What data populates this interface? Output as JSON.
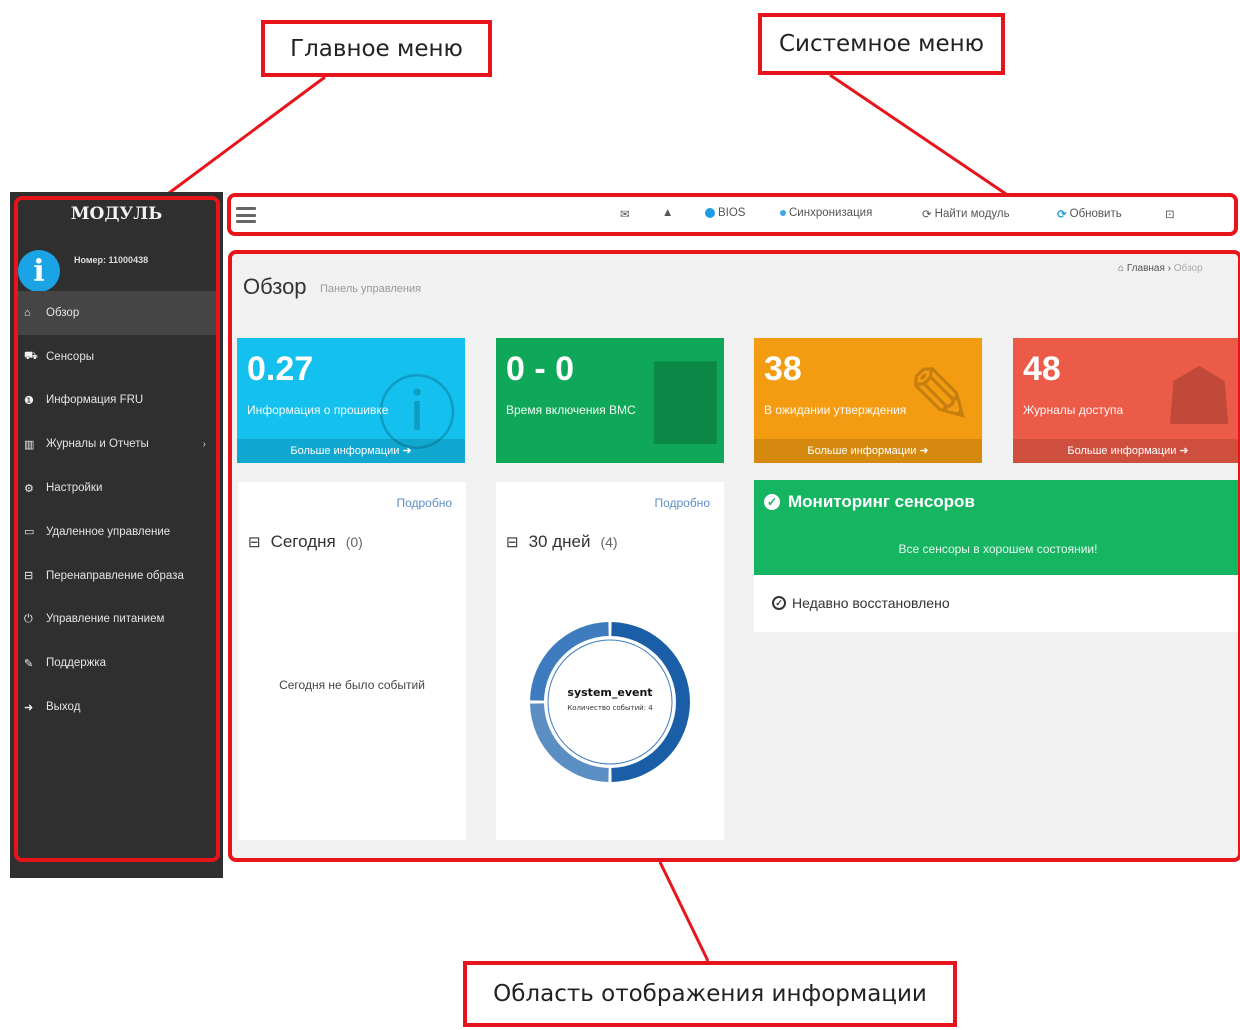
{
  "callouts": {
    "main_menu": "Главное меню",
    "system_menu": "Системное меню",
    "info_area": "Область отображения информации"
  },
  "sidebar": {
    "brand": "МОДУЛЬ",
    "user_number": "Номер: 11000438",
    "items": [
      {
        "label": "Обзор",
        "icon": "home-icon",
        "active": true
      },
      {
        "label": "Сенсоры",
        "icon": "car-icon"
      },
      {
        "label": "Информация FRU",
        "icon": "info-icon"
      },
      {
        "label": "Журналы и Отчеты",
        "icon": "bar-chart-icon",
        "has_submenu": true
      },
      {
        "label": "Настройки",
        "icon": "gear-icon"
      },
      {
        "label": "Удаленное управление",
        "icon": "monitor-icon"
      },
      {
        "label": "Перенаправление образа",
        "icon": "disk-icon"
      },
      {
        "label": "Управление питанием",
        "icon": "power-icon"
      },
      {
        "label": "Поддержка",
        "icon": "wrench-icon"
      },
      {
        "label": "Выход",
        "icon": "sign-out-icon"
      }
    ]
  },
  "topbar": {
    "bios_label": "BIOS",
    "sync_label": "Синхронизация",
    "find_label": "Найти модуль",
    "refresh_label": "Обновить",
    "icons": [
      "menu-icon",
      "envelope-icon",
      "warning-icon",
      "bios-status-icon",
      "sync-icon",
      "find-module-icon",
      "refresh-icon",
      "power-off-icon"
    ],
    "accent_color": "#1e9be6"
  },
  "content": {
    "title": "Обзор",
    "subtitle": "Панель управления",
    "breadcrumb": {
      "home": "Главная",
      "current": "Обзор"
    }
  },
  "stats": [
    {
      "value": "0.27",
      "label": "Информация о прошивке",
      "footer": "Больше информации",
      "color": "#13c0ee",
      "icon": "info-icon"
    },
    {
      "value": "0 - 0",
      "label": "Время включения BMC",
      "footer": "",
      "color": "#0fa858",
      "icon": "bar-chart-icon"
    },
    {
      "value": "38",
      "label": "В ожидании утверждения",
      "footer": "Больше информации",
      "color": "#f39c12",
      "icon": "pushpin-icon"
    },
    {
      "value": "48",
      "label": "Журналы доступа",
      "footer": "Больше информации",
      "color": "#ec5a48",
      "icon": "user-icon"
    }
  ],
  "events": {
    "today": {
      "more": "Подробно",
      "title": "Сегодня",
      "count": "(0)",
      "empty_text": "Сегодня не было событий"
    },
    "month": {
      "more": "Подробно",
      "title": "30 дней",
      "count": "(4)",
      "donut_title": "system_event",
      "donut_sub": "Количество событий: 4"
    }
  },
  "chart_data": {
    "type": "pie",
    "series": [
      {
        "values": [
          50,
          25,
          25
        ],
        "colors": [
          "#1b5ea8",
          "#5b8fc4",
          "#3f7cbf"
        ]
      }
    ],
    "center_title": "system_event",
    "center_subtitle": "Количество событий: 4"
  },
  "sensors": {
    "title": "Мониторинг сенсоров",
    "message": "Все сенсоры в хорошем состоянии!",
    "recent": "Недавно восстановлено"
  }
}
